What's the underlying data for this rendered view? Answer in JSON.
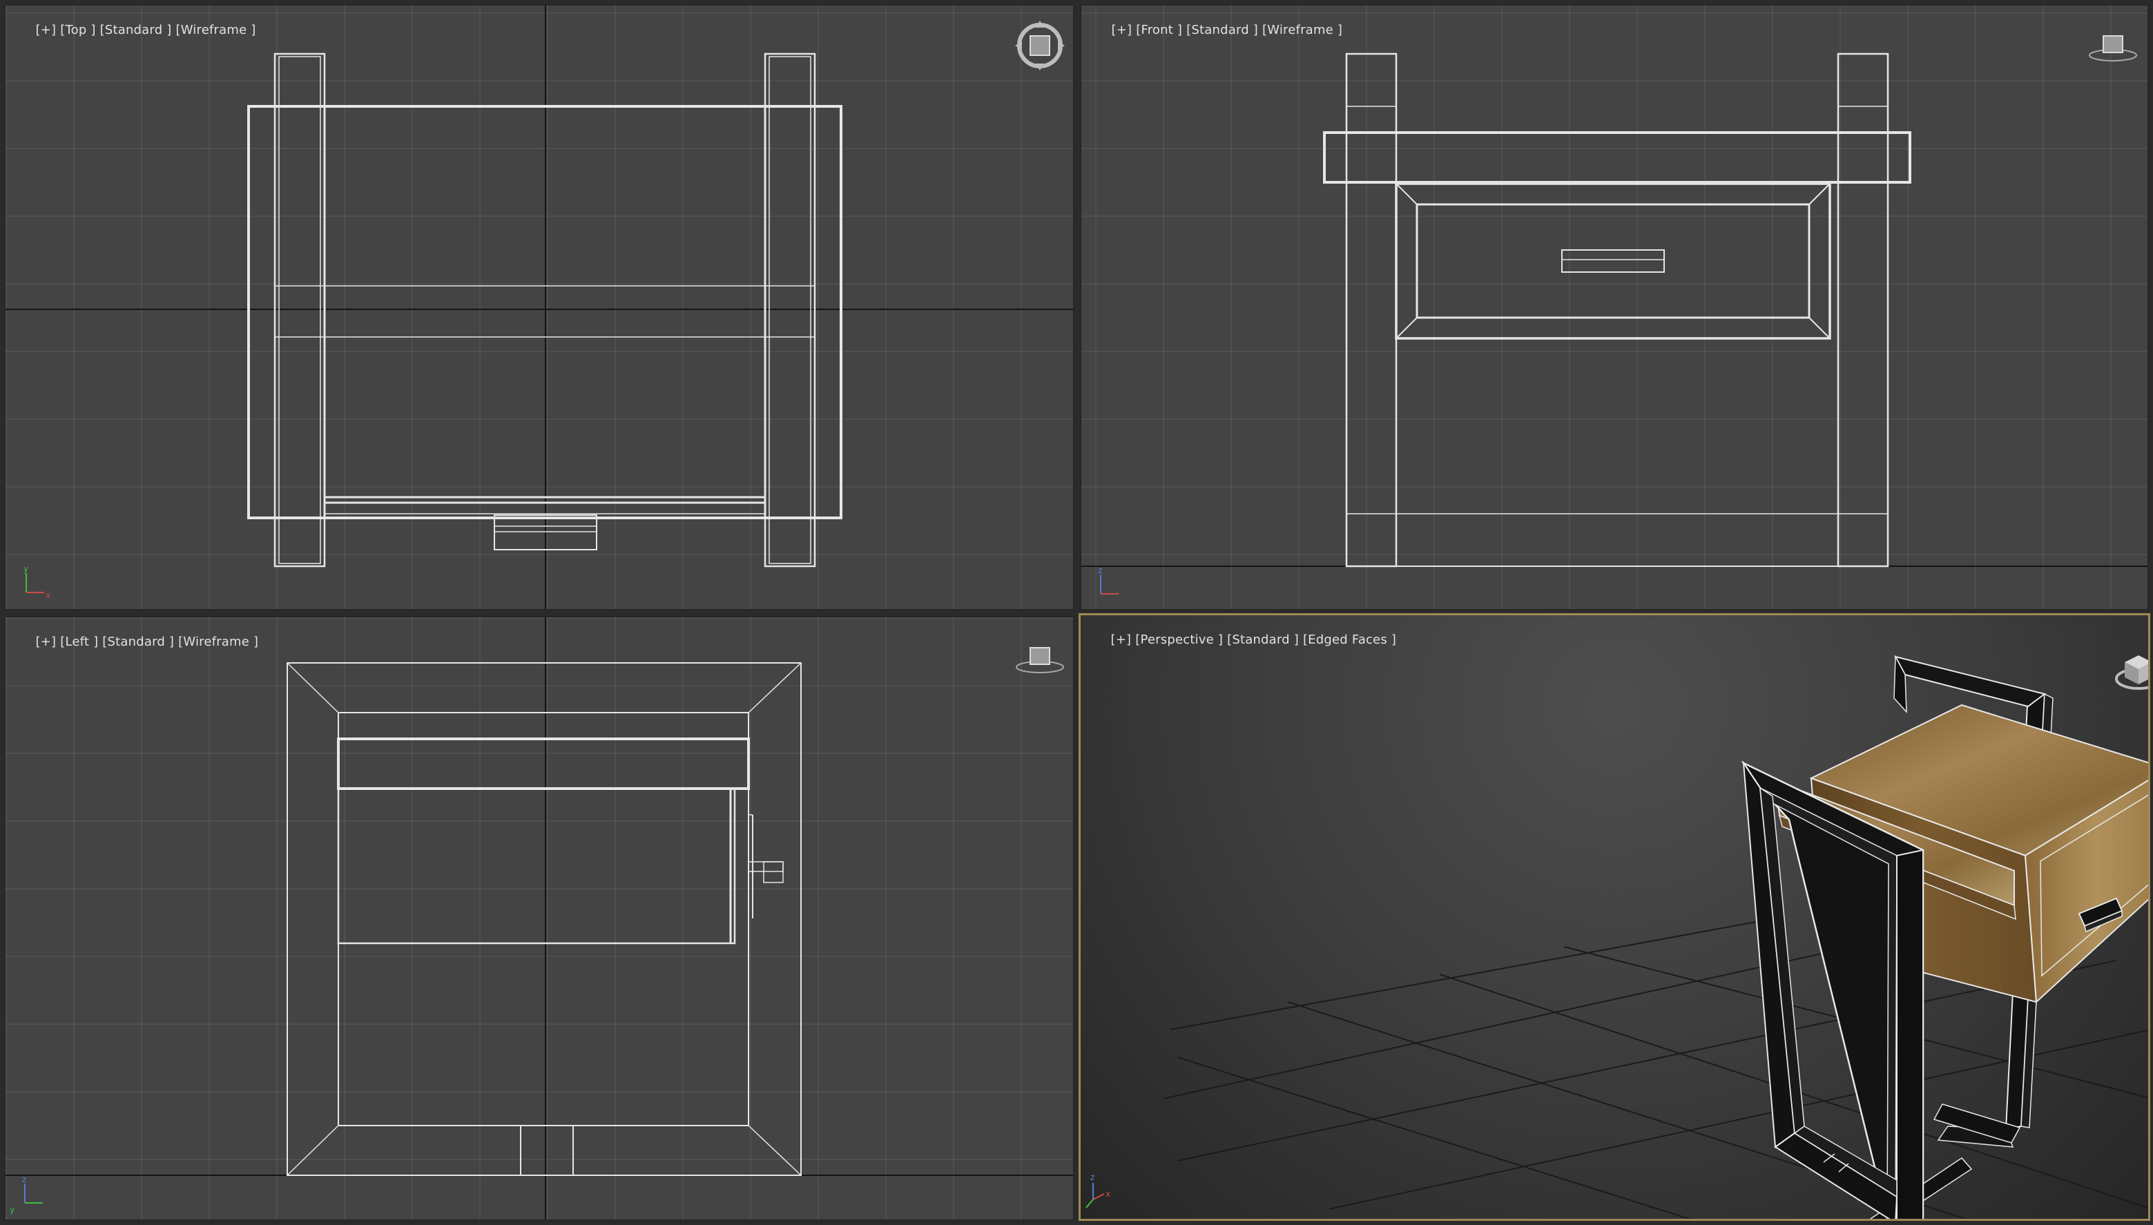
{
  "viewports": {
    "top": {
      "labels": [
        "[+]",
        "[Top ]",
        "[Standard ]",
        "[Wireframe ]"
      ]
    },
    "front": {
      "labels": [
        "[+]",
        "[Front ]",
        "[Standard ]",
        "[Wireframe ]"
      ]
    },
    "left": {
      "labels": [
        "[+]",
        "[Left ]",
        "[Standard ]",
        "[Wireframe ]"
      ]
    },
    "perspective": {
      "labels": [
        "[+]",
        "[Perspective ]",
        "[Standard ]",
        "[Edged Faces ]"
      ]
    }
  },
  "axis_labels": {
    "x": "x",
    "y": "y",
    "z": "z"
  },
  "colors": {
    "wire": "#e6e6e6",
    "viewport_bg": "#444444",
    "active_border": "#a08a55",
    "wood": "#8a6a3a",
    "metal": "#151515"
  }
}
